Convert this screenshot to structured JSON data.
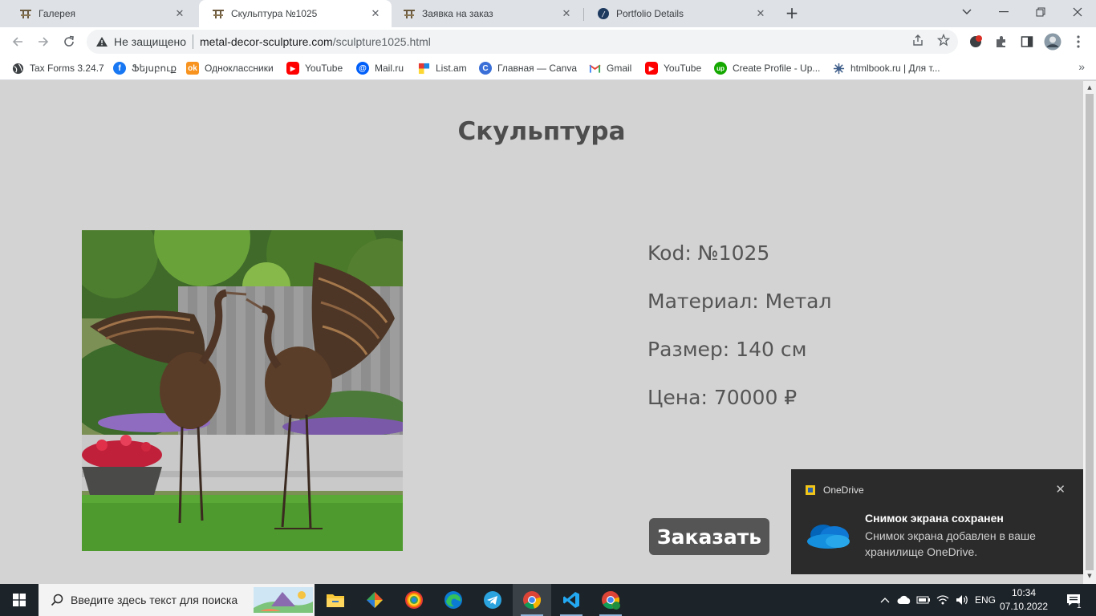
{
  "browser": {
    "tabs": [
      {
        "title": "Галерея",
        "favicon": "sculpture-favicon",
        "active": false
      },
      {
        "title": "Скульптура №1025",
        "favicon": "sculpture-favicon",
        "active": true
      },
      {
        "title": "Заявка на заказ",
        "favicon": "sculpture-favicon",
        "active": false
      },
      {
        "title": "Portfolio Details",
        "favicon": "wordpress-favicon",
        "active": false
      }
    ],
    "new_tab": "+",
    "address": {
      "security_label": "Не защищено",
      "host": "metal-decor-sculpture.com",
      "path": "/sculpture1025.html"
    },
    "bookmarks": [
      {
        "label": "Tax Forms 3.24.7",
        "icon": "globe-icon"
      },
      {
        "label": "Ֆեյսբուք",
        "icon": "facebook-icon"
      },
      {
        "label": "Одноклассники",
        "icon": "odnoklassniki-icon"
      },
      {
        "label": "YouTube",
        "icon": "youtube-icon"
      },
      {
        "label": "Mail.ru",
        "icon": "mailru-icon"
      },
      {
        "label": "List.am",
        "icon": "listam-icon"
      },
      {
        "label": "Главная — Canva",
        "icon": "canva-icon"
      },
      {
        "label": "Gmail",
        "icon": "gmail-icon"
      },
      {
        "label": "YouTube",
        "icon": "youtube-icon"
      },
      {
        "label": "Create Profile - Up...",
        "icon": "upwork-icon"
      },
      {
        "label": "htmlbook.ru | Для т...",
        "icon": "htmlbook-icon"
      }
    ],
    "bookmarks_more": "»"
  },
  "page": {
    "title": "Скульптура",
    "image_alt": "metal-crane-sculpture-photo",
    "details": [
      "Kod: №1025",
      "Материал: Метал",
      "Размер: 140 см",
      "Цена: 70000 ₽"
    ],
    "order_button": "Заказать"
  },
  "notification": {
    "app": "OneDrive",
    "title": "Снимок экрана сохранен",
    "body": "Снимок экрана добавлен в ваше хранилище OneDrive.",
    "close": "✕"
  },
  "taskbar": {
    "search_placeholder": "Введите здесь текст для поиска",
    "language": "ENG",
    "time": "10:34",
    "date": "07.10.2022",
    "notification_count": "1"
  },
  "colors": {
    "page_bg": "#d3d3d3",
    "text": "#555555",
    "button_bg": "#555555",
    "taskbar_bg": "#1c2329",
    "toast_bg": "#2b2b2b"
  }
}
